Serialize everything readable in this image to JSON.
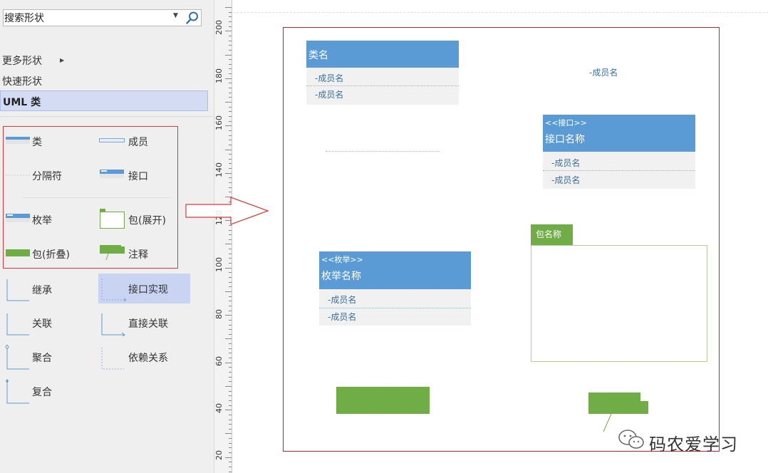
{
  "search": {
    "value": "搜索形状"
  },
  "nav": {
    "more_shapes": "更多形状",
    "quick_shapes": "快速形状",
    "uml_class": "UML 类"
  },
  "stencil": [
    {
      "label": "类",
      "icon": "class-icon"
    },
    {
      "label": "成员",
      "icon": "member-icon"
    },
    {
      "label": "分隔符",
      "icon": "separator-icon"
    },
    {
      "label": "接口",
      "icon": "interface-icon"
    },
    {
      "label": "枚举",
      "icon": "enum-icon"
    },
    {
      "label": "包(展开)",
      "icon": "package-expanded-icon"
    },
    {
      "label": "包(折叠)",
      "icon": "package-collapsed-icon"
    },
    {
      "label": "注释",
      "icon": "note-icon"
    },
    {
      "label": "继承",
      "icon": "inheritance-icon"
    },
    {
      "label": "接口实现",
      "icon": "interface-realization-icon"
    },
    {
      "label": "关联",
      "icon": "association-icon"
    },
    {
      "label": "直接关联",
      "icon": "directed-association-icon"
    },
    {
      "label": "聚合",
      "icon": "aggregation-icon"
    },
    {
      "label": "依赖关系",
      "icon": "dependency-icon"
    },
    {
      "label": "复合",
      "icon": "composition-icon"
    }
  ],
  "ruler": {
    "labels": [
      "200",
      "180",
      "160",
      "140",
      "120",
      "100",
      "80",
      "60",
      "40",
      "20"
    ]
  },
  "diagram": {
    "class_shape": {
      "name": "类名",
      "members": [
        "-成员名",
        "-成员名"
      ]
    },
    "free_member": "-成员名",
    "interface_shape": {
      "stereotype": "<<接口>>",
      "name": "接口名称",
      "members": [
        "-成员名",
        "-成员名"
      ]
    },
    "enum_shape": {
      "stereotype": "<<枚举>>",
      "name": "枚举名称",
      "members": [
        "-成员名",
        "-成员名"
      ]
    },
    "package_expanded": {
      "name": "包名称"
    }
  },
  "watermark": {
    "text": "码农爱学习"
  },
  "colors": {
    "uml_blue": "#5b9bd5",
    "package_green": "#70ad47",
    "highlight_red": "#d93a3a",
    "selection_blue": "#d3dcf3"
  }
}
